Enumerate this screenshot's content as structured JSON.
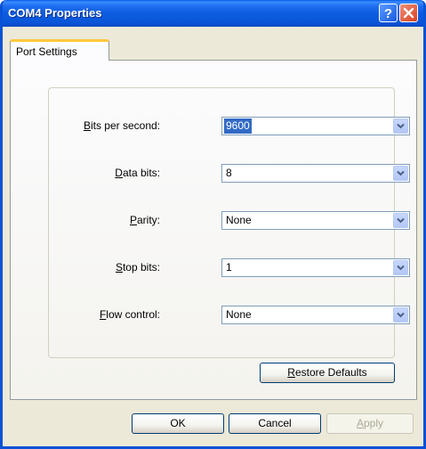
{
  "window": {
    "title": "COM4 Properties"
  },
  "tabs": [
    {
      "label": "Port Settings"
    }
  ],
  "fields": [
    {
      "label_underlined": "B",
      "label_rest": "its per second:",
      "value": "9600",
      "selected": true
    },
    {
      "label_pre": "",
      "label_underlined": "D",
      "label_rest": "ata bits:",
      "value": "8"
    },
    {
      "label_pre": "",
      "label_underlined": "P",
      "label_rest": "arity:",
      "value": "None"
    },
    {
      "label_pre": "",
      "label_underlined": "S",
      "label_rest": "top bits:",
      "value": "1"
    },
    {
      "label_pre": "",
      "label_underlined": "F",
      "label_rest": "low control:",
      "value": "None"
    }
  ],
  "restore_defaults": {
    "underlined": "R",
    "rest": "estore Defaults"
  },
  "buttons": {
    "ok": "OK",
    "cancel": "Cancel",
    "apply": "Apply"
  },
  "icons": {
    "help": "help-icon",
    "close": "close-icon",
    "dropdown": "chevron-down-icon"
  }
}
